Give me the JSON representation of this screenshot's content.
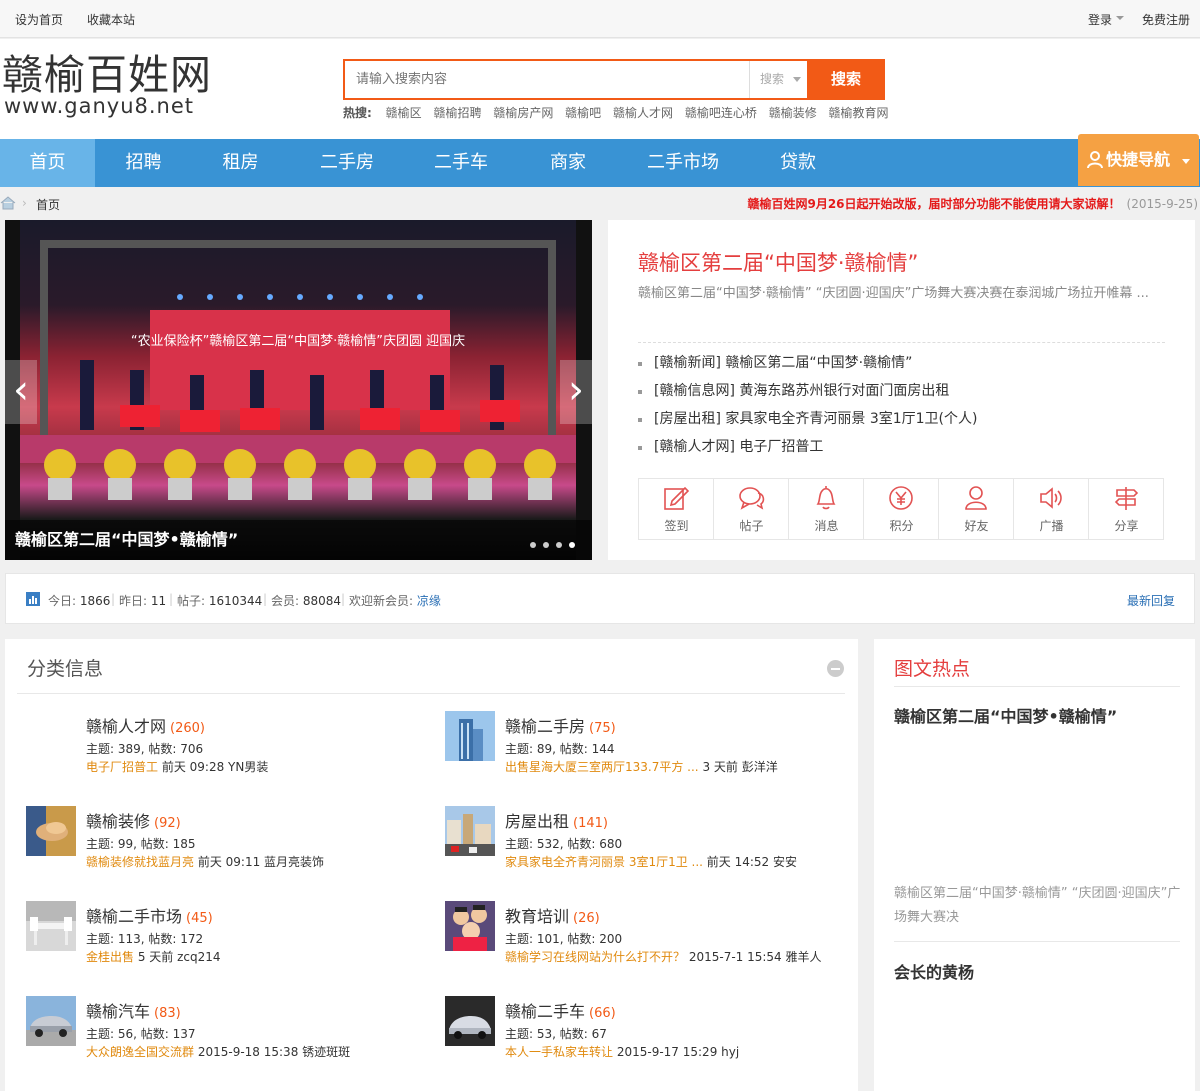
{
  "topbar": {
    "set_home": "设为首页",
    "bookmark": "收藏本站",
    "login": "登录",
    "register": "免费注册"
  },
  "header": {
    "logo_main": "赣榆百姓网",
    "logo_sub": "www.ganyu8.net"
  },
  "search": {
    "placeholder": "请输入搜索内容",
    "select": "搜索",
    "button": "搜索",
    "hot_label": "热搜:",
    "hot_words": [
      "赣榆区",
      "赣榆招聘",
      "赣榆房产网",
      "赣榆吧",
      "赣榆人才网",
      "赣榆吧连心桥",
      "赣榆装修",
      "赣榆教育网"
    ]
  },
  "nav": {
    "items": [
      "首页",
      "招聘",
      "租房",
      "二手房",
      "二手车",
      "商家",
      "二手市场",
      "贷款"
    ],
    "quick": "快捷导航"
  },
  "breadcrumb": {
    "current": "首页"
  },
  "announcement": {
    "text": "赣榆百姓网9月26日起开始改版，届时部分功能不能使用请大家谅解！",
    "date": "(2015-9-25)"
  },
  "slider": {
    "caption": "赣榆区第二届“中国梦•赣榆情”",
    "prev": "‹",
    "next": "›"
  },
  "headline": {
    "title": "赣榆区第二届“中国梦·赣榆情”",
    "desc": "赣榆区第二届“中国梦·赣榆情” “庆团圆·迎国庆”广场舞大赛决赛在泰润城广场拉开帷幕 ...",
    "items": [
      "[赣榆新闻] 赣榆区第二届“中国梦·赣榆情”",
      "[赣榆信息网] 黄海东路苏州银行对面门面房出租",
      "[房屋出租] 家具家电全齐青河丽景 3室1厅1卫(个人)",
      "[赣榆人才网] 电子厂招普工"
    ],
    "icons": [
      {
        "label": "签到",
        "icon": "edit-icon"
      },
      {
        "label": "帖子",
        "icon": "chat-icon"
      },
      {
        "label": "消息",
        "icon": "bell-icon"
      },
      {
        "label": "积分",
        "icon": "yen-icon"
      },
      {
        "label": "好友",
        "icon": "user-icon"
      },
      {
        "label": "广播",
        "icon": "speaker-icon"
      },
      {
        "label": "分享",
        "icon": "signpost-icon"
      }
    ]
  },
  "stats": {
    "today_label": "今日:",
    "today": "1866",
    "yesterday_label": "昨日:",
    "yesterday": "11",
    "posts_label": "帖子:",
    "posts": "1610344",
    "members_label": "会员:",
    "members": "88084",
    "welcome_label": "欢迎新会员:",
    "newest": "凉缘",
    "latest_reply": "最新回复"
  },
  "categories": {
    "title": "分类信息",
    "items": [
      {
        "name": "赣榆人才网",
        "count": "(260)",
        "stat": "主题: 389, 帖数: 706",
        "last_link": "电子厂招普工",
        "last_meta": " 前天 09:28 YN男装",
        "thumb": "none"
      },
      {
        "name": "赣榆二手房",
        "count": "(75)",
        "stat": "主题: 89, 帖数: 144",
        "last_link": "出售星海大厦三室两厅133.7平方 ...",
        "last_meta": " 3 天前 彭洋洋",
        "thumb": "building"
      },
      {
        "name": "赣榆装修",
        "count": "(92)",
        "stat": "主题: 99, 帖数: 185",
        "last_link": "赣榆装修就找蓝月亮",
        "last_meta": " 前天 09:11 蓝月亮装饰",
        "thumb": "handshake"
      },
      {
        "name": "房屋出租",
        "count": "(141)",
        "stat": "主题: 532, 帖数: 680",
        "last_link": "家具家电全齐青河丽景 3室1厅1卫 ...",
        "last_meta": " 前天 14:52 安安",
        "thumb": "street"
      },
      {
        "name": "赣榆二手市场",
        "count": "(45)",
        "stat": "主题: 113, 帖数: 172",
        "last_link": "金桂出售",
        "last_meta": " 5 天前 zcq214",
        "thumb": "furniture"
      },
      {
        "name": "教育培训",
        "count": "(26)",
        "stat": "主题: 101, 帖数: 200",
        "last_link": "赣榆学习在线网站为什么打不开？",
        "last_meta": " 2015-7-1 15:54 雅羊人",
        "thumb": "kids"
      },
      {
        "name": "赣榆汽车",
        "count": "(83)",
        "stat": "主题: 56, 帖数: 137",
        "last_link": "大众朗逸全国交流群",
        "last_meta": " 2015-9-18 15:38 锈迹斑斑",
        "thumb": "car"
      },
      {
        "name": "赣榆二手车",
        "count": "(66)",
        "stat": "主题: 53, 帖数: 67",
        "last_link": "本人一手私家车转让",
        "last_meta": " 2015-9-17 15:29 hyj",
        "thumb": "car2"
      }
    ]
  },
  "hot": {
    "title": "图文热点",
    "headline": "赣榆区第二届“中国梦•赣榆情”",
    "desc": "赣榆区第二届“中国梦·赣榆情” “庆团圆·迎国庆”广场舞大赛决",
    "headline2": "会长的黄杨"
  }
}
